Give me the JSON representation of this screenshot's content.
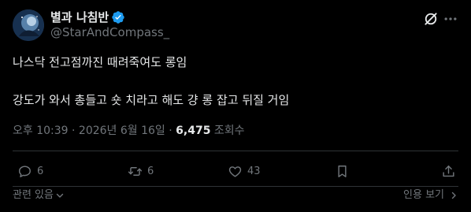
{
  "colors": {
    "background": "#000000",
    "text_primary": "#e7e9ea",
    "text_secondary": "#71767b",
    "verified_blue": "#1d9bf0",
    "divider": "#2f3336"
  },
  "author": {
    "display_name": "별과 나침반",
    "handle": "@StarAndCompass_",
    "verified": true
  },
  "header_icons": [
    "grok-icon",
    "more-icon"
  ],
  "tweet": {
    "line1": "나스닥 전고점까진 때려죽여도 롱임",
    "line2": "강도가 와서 총들고 숏 치라고 해도 걍 롱 잡고 뒤질 거임"
  },
  "meta": {
    "timestamp": "오후 10:39 · 2026년 6월 16일 · ",
    "views_count": "6,475",
    "views_label": " 조회수"
  },
  "actions": {
    "reply_count": "6",
    "retweet_count": "6",
    "like_count": "43"
  },
  "footer": {
    "related_label": "관련 있음",
    "quotes_label": "인용 보기"
  }
}
